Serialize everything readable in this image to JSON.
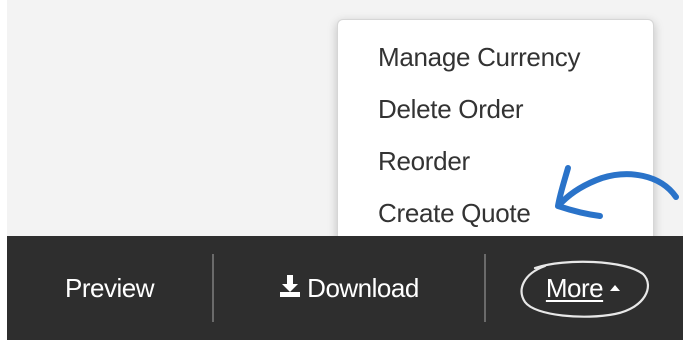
{
  "menu": {
    "items": [
      {
        "label": "Manage Currency"
      },
      {
        "label": "Delete Order"
      },
      {
        "label": "Reorder"
      },
      {
        "label": "Create Quote"
      }
    ]
  },
  "toolbar": {
    "preview_label": "Preview",
    "download_label": "Download",
    "more_label": "More"
  },
  "icons": {
    "download": "download-icon",
    "more_caret": "caret-up-icon"
  },
  "colors": {
    "toolbar_bg": "#2e2e2e",
    "annotation_arrow": "#2a73c9",
    "menu_text": "#333333"
  }
}
